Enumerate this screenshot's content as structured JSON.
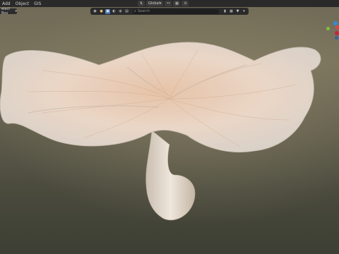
{
  "menubar": {
    "items": [
      "Add",
      "Object",
      "GIS"
    ]
  },
  "header": {
    "orientation_label": "Global",
    "orientation_chevron": "▾",
    "link_icon": "link-icon",
    "snap_icon": "snap-icon",
    "proportional_icon": "proportional-icon"
  },
  "toolbar": {
    "select_box_label": "elect Box",
    "search_placeholder": "Search",
    "tools": [
      "view-icon",
      "shading-icon",
      "display-icon",
      "render-icon",
      "lock-icon",
      "camera-icon"
    ],
    "filter_icon": "filter-icon",
    "bookmark_icon": "bookmark-icon"
  },
  "gizmo": {
    "axis_colors": [
      "#2f8dde",
      "#d84a4a",
      "#7cc13c",
      "#c4263a"
    ]
  },
  "scene": {
    "subject": "mushroom"
  }
}
